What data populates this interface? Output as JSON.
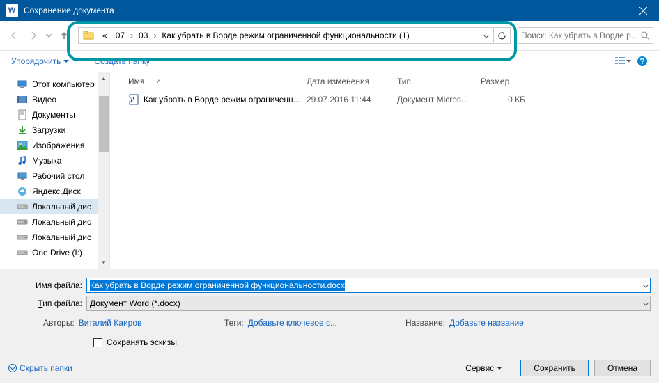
{
  "title": "Сохранение документа",
  "breadcrumb": {
    "prefix": "«",
    "parts": [
      "07",
      "03",
      "Как убрать в Ворде режим ограниченной функциональности (1)"
    ]
  },
  "search_placeholder": "Поиск: Как убрать в Ворде р...",
  "toolbar": {
    "organize": "Упорядочить",
    "new_folder": "Создать папку"
  },
  "columns": {
    "name": "Имя",
    "date": "Дата изменения",
    "type": "Тип",
    "size": "Размер"
  },
  "tree": [
    {
      "label": "Этот компьютер",
      "icon": "pc"
    },
    {
      "label": "Видео",
      "icon": "video"
    },
    {
      "label": "Документы",
      "icon": "docs"
    },
    {
      "label": "Загрузки",
      "icon": "down"
    },
    {
      "label": "Изображения",
      "icon": "pics"
    },
    {
      "label": "Музыка",
      "icon": "music"
    },
    {
      "label": "Рабочий стол",
      "icon": "desk"
    },
    {
      "label": "Яндекс.Диск",
      "icon": "ydisk"
    },
    {
      "label": "Локальный дис",
      "icon": "drive",
      "selected": true
    },
    {
      "label": "Локальный дис",
      "icon": "drive"
    },
    {
      "label": "Локальный дис",
      "icon": "drive"
    },
    {
      "label": "One Drive (I:)",
      "icon": "drive"
    }
  ],
  "files": [
    {
      "name": "Как убрать в Ворде режим ограниченн...",
      "date": "29.07.2016 11:44",
      "type": "Документ Micros...",
      "size": "0 КБ"
    }
  ],
  "filename_label": "Имя файла:",
  "filename_value": "Как убрать в Ворде режим ограниченной функциональности.docx",
  "filetype_label": "Тип файла:",
  "filetype_value": "Документ Word (*.docx)",
  "meta": {
    "authors_label": "Авторы:",
    "authors_value": "Виталий Каиров",
    "tags_label": "Теги:",
    "tags_value": "Добавьте ключевое с...",
    "title_label": "Название:",
    "title_value": "Добавьте название"
  },
  "save_thumbs": "Сохранять эскизы",
  "hide_folders": "Скрыть папки",
  "service": "Сервис",
  "save": "Сохранить",
  "cancel": "Отмена"
}
